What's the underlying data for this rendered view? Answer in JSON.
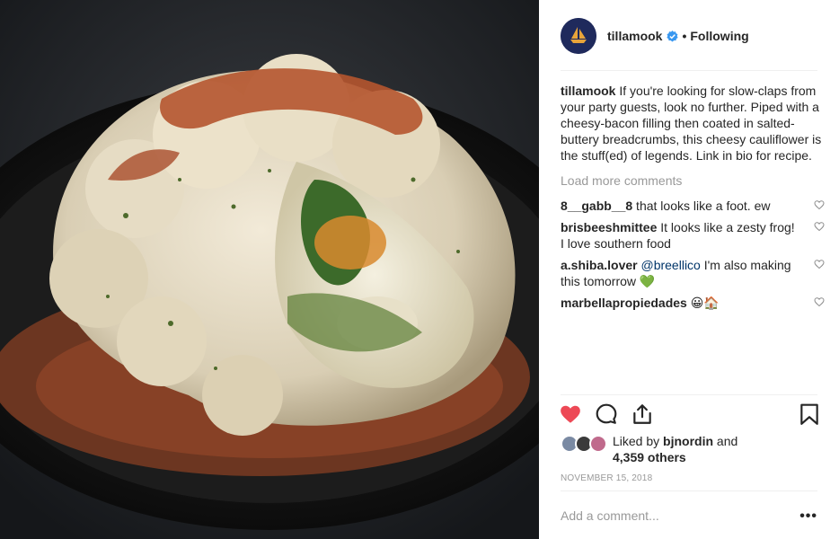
{
  "post": {
    "username": "tillamook",
    "follow_status": "Following",
    "separator": "•",
    "caption_user": "tillamook",
    "caption_text": " If you're looking for slow-claps from your party guests, look no further. Piped with a cheesy-bacon filling then coated in salted-buttery breadcrumbs, this cheesy cauliflower is the stuff(ed) of legends. Link in bio for recipe.",
    "load_more": "Load more comments",
    "comments": [
      {
        "user": "8__gabb__8",
        "text": " that looks like a foot. ew"
      },
      {
        "user": "brisbeeshmittee",
        "text": " It looks like a zesty frog! I love southern food"
      },
      {
        "user": "a.shiba.lover",
        "mention": "@breellico",
        "text": " I'm also making this tomorrow 💚"
      },
      {
        "user": "marbellapropiedades",
        "text": " 😀🏠"
      }
    ],
    "liked_prefix": "Liked by ",
    "liked_user": "bjnordin",
    "liked_and": " and",
    "likes_count": "4,359 others",
    "date": "NOVEMBER 15, 2018",
    "add_comment_placeholder": "Add a comment...",
    "more_options": "•••"
  },
  "colors": {
    "accent_heart": "#ed4956",
    "verified": "#3897f0",
    "avatar_bg": "#1f2a5c",
    "avatar_ship": "#e8a43a",
    "mention": "#003569"
  },
  "icons": {
    "heart": "heart-filled-icon",
    "comment": "comment-icon",
    "share": "share-icon",
    "save": "bookmark-icon",
    "verified": "verified-badge-icon",
    "comment_like": "heart-outline-icon"
  }
}
